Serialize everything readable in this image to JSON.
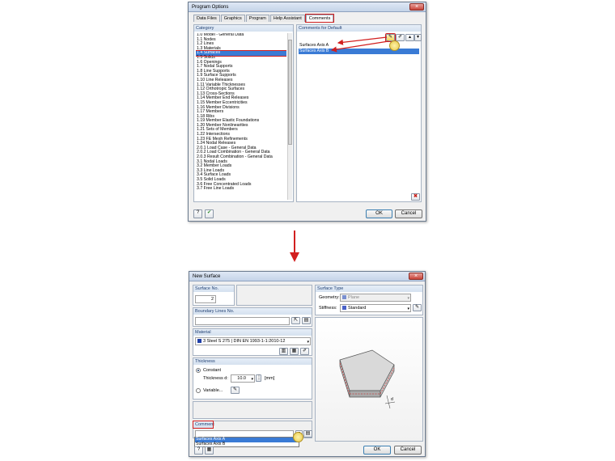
{
  "top_window": {
    "title": "Program Options",
    "tabs": [
      "Data Files",
      "Graphics",
      "Program",
      "Help Assistant",
      "Comments"
    ],
    "category_label": "Category",
    "categories": [
      "1.0 Model - General Data",
      "1.1 Nodes",
      "1.2 Lines",
      "1.3 Materials",
      "1.4 Surfaces",
      "1.5 Solids",
      "1.6 Openings",
      "1.7 Nodal Supports",
      "1.8 Line Supports",
      "1.9 Surface Supports",
      "1.10 Line Releases",
      "1.11 Variable Thicknesses",
      "1.12 Orthotropic Surfaces",
      "1.13 Cross-Sections",
      "1.14 Member End Releases",
      "1.15 Member Eccentricities",
      "1.16 Member Divisions",
      "1.17 Members",
      "1.18 Ribs",
      "1.19 Member Elastic Foundations",
      "1.20 Member Nonlinearities",
      "1.21 Sets of Members",
      "1.22 Intersections",
      "1.23 FE Mesh Refinements",
      "1.24 Nodal Releases",
      "2.0.1 Load Case - General Data",
      "2.0.2 Load Combination - General Data",
      "2.0.3 Result Combination - General Data",
      "3.1 Nodal Loads",
      "3.2 Member Loads",
      "3.3 Line Loads",
      "3.4 Surface Loads",
      "3.5 Solid Loads",
      "3.6 Free Concentrated Loads",
      "3.7 Free Line Loads"
    ],
    "selected_category_index": 4,
    "comments_label": "Comments for Default",
    "comments": [
      "Surfaces Axis A",
      "Surfaces Axis B"
    ],
    "ok": "OK",
    "cancel": "Cancel"
  },
  "bottom_window": {
    "title": "New Surface",
    "surface_no_label": "Surface No.",
    "surface_no": "2",
    "boundary_lines_label": "Boundary Lines No.",
    "material_label": "Material",
    "material_value": "3 Steel S 275 | DIN EN 1993-1-1:2010-12",
    "thickness_label": "Thickness",
    "constant_label": "Constant",
    "thickness_d_label": "Thickness d:",
    "thickness_value": "10.0",
    "thickness_unit": "[mm]",
    "variable_label": "Variable...",
    "comment_label": "Comment",
    "comment_options": [
      "Surfaces Axis A",
      "Surfaces Axis B"
    ],
    "surface_type_label": "Surface Type",
    "geometry_label": "Geometry:",
    "geometry_value": "Plane",
    "stiffness_label": "Stiffness:",
    "stiffness_value": "Standard",
    "dim_label": "d",
    "ok": "OK",
    "cancel": "Cancel"
  },
  "colors": {
    "highlight": "#d21f1f",
    "selection": "#3a7bd5",
    "material_swatch": "#1f3fa8",
    "arrow": "#d21f1f"
  }
}
